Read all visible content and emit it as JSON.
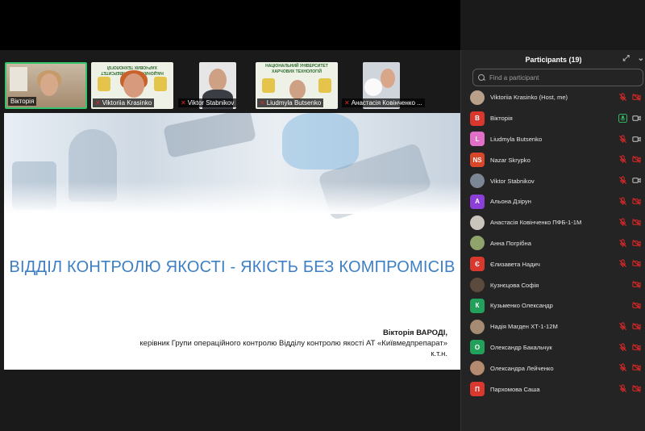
{
  "video_strip": {
    "tiles": [
      {
        "name": "Вікторія",
        "muted": false
      },
      {
        "name": "Viktoriia Krasinko",
        "muted": true
      },
      {
        "name": "Viktor Stabnikov",
        "muted": true
      },
      {
        "name": "Liudmyla Butsenko",
        "muted": true
      },
      {
        "name": "Анастасія Ковінченко ...",
        "muted": true
      }
    ],
    "banner_2": "НАЦІОНАЛЬНИЙ УНІВЕРСИТЕТ ХАРЧОВИХ ТЕХНОЛОГІЙ",
    "banner_4": "НАЦІОНАЛЬНИЙ УНІВЕРСИТЕТ ХАРЧОВИХ ТЕХНОЛОГІЙ"
  },
  "slide": {
    "title": "ВІДДІЛ КОНТРОЛЮ ЯКОСТІ - ЯКІСТЬ БЕЗ КОМПРОМІСІВ",
    "author_name": "Вікторія ВАРОДІ,",
    "author_position": "керівник Групи операційного контролю Відділу контролю якості АТ «Київмедпрепарат»",
    "author_degree": "к.т.н."
  },
  "participants": {
    "title": "Participants (19)",
    "search_placeholder": "Find a participant",
    "items": [
      {
        "name": "Viktoriia Krasinko (Host, me)",
        "avatar_text": "",
        "avatar_color": "#b9a08a",
        "mic": "muted",
        "video": "off"
      },
      {
        "name": "Вікторія",
        "avatar_text": "В",
        "avatar_color": "#d9382e",
        "mic": "on",
        "video": "on"
      },
      {
        "name": "Liudmyla Butsenko",
        "avatar_text": "L",
        "avatar_color": "#e26fc6",
        "mic": "muted",
        "video": "on"
      },
      {
        "name": "Nazar Skrypko",
        "avatar_text": "NS",
        "avatar_color": "#d9472b",
        "mic": "muted",
        "video": "off"
      },
      {
        "name": "Viktor Stabnikov",
        "avatar_text": "",
        "avatar_color": "#7b8794",
        "mic": "muted",
        "video": "on"
      },
      {
        "name": "Альона Дзірун",
        "avatar_text": "А",
        "avatar_color": "#8b3fd6",
        "mic": "muted",
        "video": "off"
      },
      {
        "name": "Анастасія Ковінченко ПФБ-1-1М",
        "avatar_text": "",
        "avatar_color": "#c9c4bc",
        "mic": "muted",
        "video": "off"
      },
      {
        "name": "Анна Погрібна",
        "avatar_text": "",
        "avatar_color": "#8fa36a",
        "mic": "muted",
        "video": "off"
      },
      {
        "name": "Єлизавета Надич",
        "avatar_text": "Є",
        "avatar_color": "#d9382e",
        "mic": "muted",
        "video": "off"
      },
      {
        "name": "Кузнєцова Софія",
        "avatar_text": "",
        "avatar_color": "#5b4a3e",
        "mic": "",
        "video": "off"
      },
      {
        "name": "Кузьменко Олександр",
        "avatar_text": "К",
        "avatar_color": "#23a05a",
        "mic": "",
        "video": "off"
      },
      {
        "name": "Надія Магден ХТ-1-12М",
        "avatar_text": "",
        "avatar_color": "#a68b74",
        "mic": "muted",
        "video": "off"
      },
      {
        "name": "Олександр Бакальчук",
        "avatar_text": "О",
        "avatar_color": "#23a05a",
        "mic": "muted",
        "video": "off"
      },
      {
        "name": "Олександра Лейченко",
        "avatar_text": "",
        "avatar_color": "#b58a70",
        "mic": "muted",
        "video": "off"
      },
      {
        "name": "Пархомова Саша",
        "avatar_text": "П",
        "avatar_color": "#d9382e",
        "mic": "muted",
        "video": "off"
      }
    ]
  },
  "colors": {
    "background": "#1a1a1a",
    "panel": "#242424",
    "muted_red": "#e02828",
    "active_green": "#35c46b",
    "slide_title": "#3d7fc4"
  }
}
